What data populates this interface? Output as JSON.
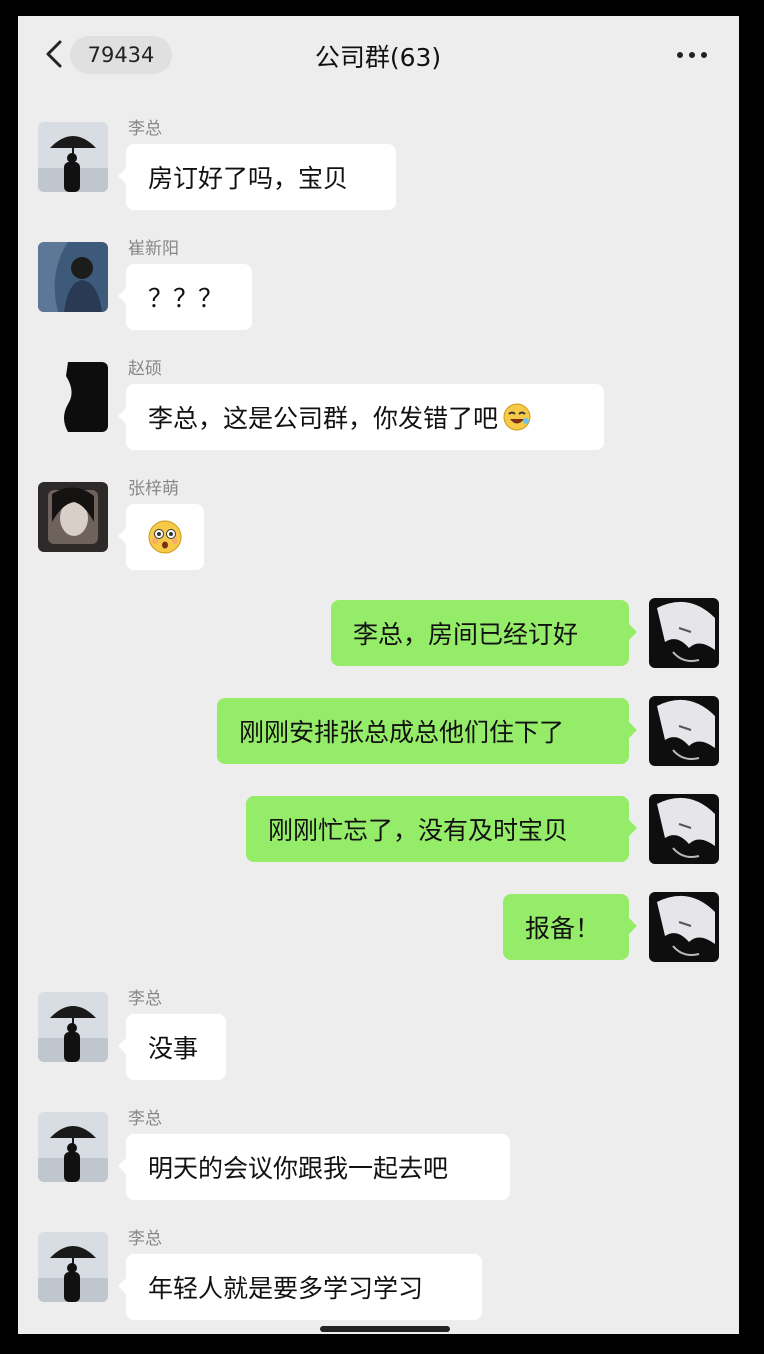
{
  "header": {
    "unread_count": "79434",
    "title": "公司群(63)"
  },
  "messages": [
    {
      "sender": "李总",
      "text": "房订好了吗，宝贝",
      "side": "in",
      "avatar": "umbrella-avatar-icon"
    },
    {
      "sender": "崔新阳",
      "text": "？？？",
      "side": "in",
      "avatar": "person-avatar-icon"
    },
    {
      "sender": "赵硕",
      "text": "李总，这是公司群，你发错了吧",
      "side": "in",
      "avatar": "silhouette-avatar-icon",
      "emoji": "laughing-emoji-icon"
    },
    {
      "sender": "张梓萌",
      "text": "",
      "side": "in",
      "avatar": "girl-avatar-icon",
      "emoji": "astonished-emoji-icon"
    },
    {
      "text": "李总，房间已经订好",
      "side": "out",
      "avatar": "anime-avatar-icon"
    },
    {
      "text": "刚刚安排张总成总他们住下了",
      "side": "out",
      "avatar": "anime-avatar-icon"
    },
    {
      "text": "刚刚忙忘了，没有及时宝贝",
      "side": "out",
      "avatar": "anime-avatar-icon"
    },
    {
      "text": "报备！",
      "side": "out",
      "avatar": "anime-avatar-icon"
    },
    {
      "sender": "李总",
      "text": "没事",
      "side": "in",
      "avatar": "umbrella-avatar-icon"
    },
    {
      "sender": "李总",
      "text": "明天的会议你跟我一起去吧",
      "side": "in",
      "avatar": "umbrella-avatar-icon"
    },
    {
      "sender": "李总",
      "text": "年轻人就是要多学习学习",
      "side": "in",
      "avatar": "umbrella-avatar-icon"
    }
  ],
  "colors": {
    "background": "#ededed",
    "incoming_bubble": "#ffffff",
    "outgoing_bubble": "#95ec69"
  }
}
